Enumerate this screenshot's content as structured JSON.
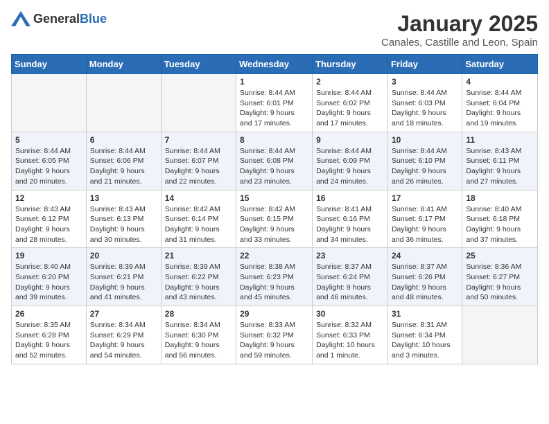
{
  "logo": {
    "general": "General",
    "blue": "Blue"
  },
  "header": {
    "month": "January 2025",
    "location": "Canales, Castille and Leon, Spain"
  },
  "weekdays": [
    "Sunday",
    "Monday",
    "Tuesday",
    "Wednesday",
    "Thursday",
    "Friday",
    "Saturday"
  ],
  "weeks": [
    [
      {
        "day": "",
        "sunrise": "",
        "sunset": "",
        "daylight": ""
      },
      {
        "day": "",
        "sunrise": "",
        "sunset": "",
        "daylight": ""
      },
      {
        "day": "",
        "sunrise": "",
        "sunset": "",
        "daylight": ""
      },
      {
        "day": "1",
        "sunrise": "Sunrise: 8:44 AM",
        "sunset": "Sunset: 6:01 PM",
        "daylight": "Daylight: 9 hours and 17 minutes."
      },
      {
        "day": "2",
        "sunrise": "Sunrise: 8:44 AM",
        "sunset": "Sunset: 6:02 PM",
        "daylight": "Daylight: 9 hours and 17 minutes."
      },
      {
        "day": "3",
        "sunrise": "Sunrise: 8:44 AM",
        "sunset": "Sunset: 6:03 PM",
        "daylight": "Daylight: 9 hours and 18 minutes."
      },
      {
        "day": "4",
        "sunrise": "Sunrise: 8:44 AM",
        "sunset": "Sunset: 6:04 PM",
        "daylight": "Daylight: 9 hours and 19 minutes."
      }
    ],
    [
      {
        "day": "5",
        "sunrise": "Sunrise: 8:44 AM",
        "sunset": "Sunset: 6:05 PM",
        "daylight": "Daylight: 9 hours and 20 minutes."
      },
      {
        "day": "6",
        "sunrise": "Sunrise: 8:44 AM",
        "sunset": "Sunset: 6:06 PM",
        "daylight": "Daylight: 9 hours and 21 minutes."
      },
      {
        "day": "7",
        "sunrise": "Sunrise: 8:44 AM",
        "sunset": "Sunset: 6:07 PM",
        "daylight": "Daylight: 9 hours and 22 minutes."
      },
      {
        "day": "8",
        "sunrise": "Sunrise: 8:44 AM",
        "sunset": "Sunset: 6:08 PM",
        "daylight": "Daylight: 9 hours and 23 minutes."
      },
      {
        "day": "9",
        "sunrise": "Sunrise: 8:44 AM",
        "sunset": "Sunset: 6:09 PM",
        "daylight": "Daylight: 9 hours and 24 minutes."
      },
      {
        "day": "10",
        "sunrise": "Sunrise: 8:44 AM",
        "sunset": "Sunset: 6:10 PM",
        "daylight": "Daylight: 9 hours and 26 minutes."
      },
      {
        "day": "11",
        "sunrise": "Sunrise: 8:43 AM",
        "sunset": "Sunset: 6:11 PM",
        "daylight": "Daylight: 9 hours and 27 minutes."
      }
    ],
    [
      {
        "day": "12",
        "sunrise": "Sunrise: 8:43 AM",
        "sunset": "Sunset: 6:12 PM",
        "daylight": "Daylight: 9 hours and 28 minutes."
      },
      {
        "day": "13",
        "sunrise": "Sunrise: 8:43 AM",
        "sunset": "Sunset: 6:13 PM",
        "daylight": "Daylight: 9 hours and 30 minutes."
      },
      {
        "day": "14",
        "sunrise": "Sunrise: 8:42 AM",
        "sunset": "Sunset: 6:14 PM",
        "daylight": "Daylight: 9 hours and 31 minutes."
      },
      {
        "day": "15",
        "sunrise": "Sunrise: 8:42 AM",
        "sunset": "Sunset: 6:15 PM",
        "daylight": "Daylight: 9 hours and 33 minutes."
      },
      {
        "day": "16",
        "sunrise": "Sunrise: 8:41 AM",
        "sunset": "Sunset: 6:16 PM",
        "daylight": "Daylight: 9 hours and 34 minutes."
      },
      {
        "day": "17",
        "sunrise": "Sunrise: 8:41 AM",
        "sunset": "Sunset: 6:17 PM",
        "daylight": "Daylight: 9 hours and 36 minutes."
      },
      {
        "day": "18",
        "sunrise": "Sunrise: 8:40 AM",
        "sunset": "Sunset: 6:18 PM",
        "daylight": "Daylight: 9 hours and 37 minutes."
      }
    ],
    [
      {
        "day": "19",
        "sunrise": "Sunrise: 8:40 AM",
        "sunset": "Sunset: 6:20 PM",
        "daylight": "Daylight: 9 hours and 39 minutes."
      },
      {
        "day": "20",
        "sunrise": "Sunrise: 8:39 AM",
        "sunset": "Sunset: 6:21 PM",
        "daylight": "Daylight: 9 hours and 41 minutes."
      },
      {
        "day": "21",
        "sunrise": "Sunrise: 8:39 AM",
        "sunset": "Sunset: 6:22 PM",
        "daylight": "Daylight: 9 hours and 43 minutes."
      },
      {
        "day": "22",
        "sunrise": "Sunrise: 8:38 AM",
        "sunset": "Sunset: 6:23 PM",
        "daylight": "Daylight: 9 hours and 45 minutes."
      },
      {
        "day": "23",
        "sunrise": "Sunrise: 8:37 AM",
        "sunset": "Sunset: 6:24 PM",
        "daylight": "Daylight: 9 hours and 46 minutes."
      },
      {
        "day": "24",
        "sunrise": "Sunrise: 8:37 AM",
        "sunset": "Sunset: 6:26 PM",
        "daylight": "Daylight: 9 hours and 48 minutes."
      },
      {
        "day": "25",
        "sunrise": "Sunrise: 8:36 AM",
        "sunset": "Sunset: 6:27 PM",
        "daylight": "Daylight: 9 hours and 50 minutes."
      }
    ],
    [
      {
        "day": "26",
        "sunrise": "Sunrise: 8:35 AM",
        "sunset": "Sunset: 6:28 PM",
        "daylight": "Daylight: 9 hours and 52 minutes."
      },
      {
        "day": "27",
        "sunrise": "Sunrise: 8:34 AM",
        "sunset": "Sunset: 6:29 PM",
        "daylight": "Daylight: 9 hours and 54 minutes."
      },
      {
        "day": "28",
        "sunrise": "Sunrise: 8:34 AM",
        "sunset": "Sunset: 6:30 PM",
        "daylight": "Daylight: 9 hours and 56 minutes."
      },
      {
        "day": "29",
        "sunrise": "Sunrise: 8:33 AM",
        "sunset": "Sunset: 6:32 PM",
        "daylight": "Daylight: 9 hours and 59 minutes."
      },
      {
        "day": "30",
        "sunrise": "Sunrise: 8:32 AM",
        "sunset": "Sunset: 6:33 PM",
        "daylight": "Daylight: 10 hours and 1 minute."
      },
      {
        "day": "31",
        "sunrise": "Sunrise: 8:31 AM",
        "sunset": "Sunset: 6:34 PM",
        "daylight": "Daylight: 10 hours and 3 minutes."
      },
      {
        "day": "",
        "sunrise": "",
        "sunset": "",
        "daylight": ""
      }
    ]
  ]
}
